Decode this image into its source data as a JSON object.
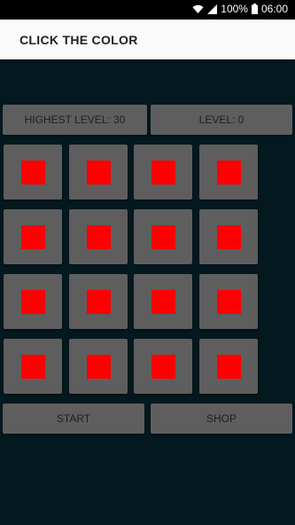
{
  "status_bar": {
    "battery": "100%",
    "time": "06:00",
    "icons": [
      "wifi-icon",
      "signal-icon",
      "battery-icon"
    ]
  },
  "app_bar": {
    "title": "CLICK THE COLOR"
  },
  "scores": {
    "highest_level": "HIGHEST LEVEL: 30",
    "level": "LEVEL: 0"
  },
  "grid": {
    "rows": 4,
    "cols": 4,
    "tile_color": "#5e5e5e",
    "swatch_color": "#ff0000"
  },
  "actions": {
    "start_label": "START",
    "shop_label": "SHOP"
  },
  "colors": {
    "background": "#041820",
    "app_bar": "#fafafa",
    "button": "#5e5e5e"
  }
}
